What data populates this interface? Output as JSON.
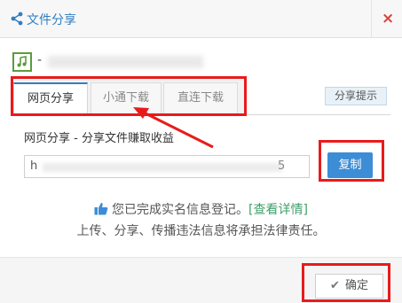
{
  "window": {
    "title": "文件分享",
    "close_glyph": "×"
  },
  "file": {
    "name_prefix": "-"
  },
  "tabs": [
    {
      "label": "网页分享",
      "active": true
    },
    {
      "label": "小通下载",
      "active": false
    },
    {
      "label": "直连下载",
      "active": false
    }
  ],
  "hint_button": "分享提示",
  "description": "网页分享 - 分享文件赚取收益",
  "link": {
    "prefix": "h",
    "suffix": "5"
  },
  "copy_button": "复制",
  "notice": {
    "line1_text": "您已完成实名信息登记。",
    "line1_link": "[查看详情]",
    "line2_text": "上传、分享、传播违法信息将承担法律责任。"
  },
  "ok_button": "确定",
  "colors": {
    "accent": "#2f7ec2",
    "highlight_annotation": "#e81b1b",
    "link_green": "#3e9f6b",
    "close_red": "#d8433c"
  },
  "icons": [
    "share-icon",
    "close-icon",
    "music-file-icon",
    "thumbs-up-icon",
    "check-icon",
    "annotation-arrow"
  ]
}
